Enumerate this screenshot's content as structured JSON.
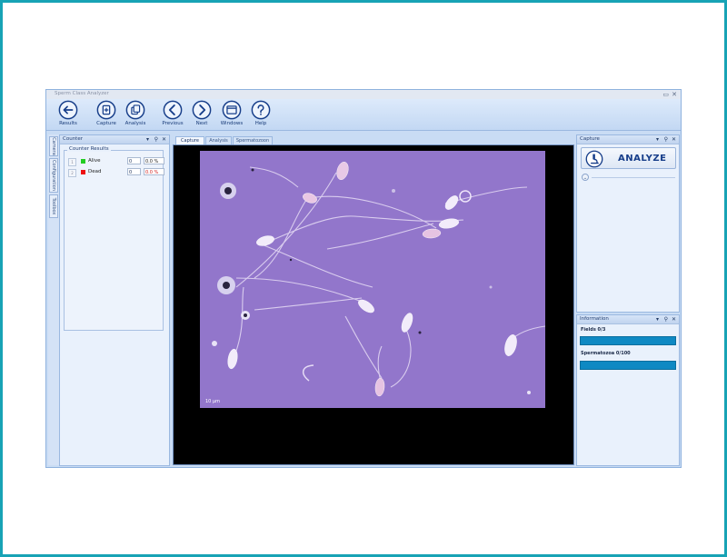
{
  "window": {
    "title": "Sperm Class Analyzer"
  },
  "toolbar": {
    "buttons": [
      {
        "label": "Results",
        "icon": "arrow-left-icon"
      },
      {
        "label": "Capture",
        "icon": "capture-icon"
      },
      {
        "label": "Analysis",
        "icon": "analysis-icon"
      },
      {
        "label": "Previous",
        "icon": "chevron-left-icon"
      },
      {
        "label": "Next",
        "icon": "chevron-right-icon"
      },
      {
        "label": "Windows",
        "icon": "windows-icon"
      },
      {
        "label": "Help",
        "icon": "help-icon"
      }
    ]
  },
  "side_tabs": [
    "Camera",
    "Configuration",
    "Toolbox"
  ],
  "counter_panel": {
    "title": "Counter",
    "group_title": "Counter Results",
    "rows": [
      {
        "index": "1",
        "name": "Alive",
        "color": "#22cc22",
        "count": "0",
        "percent": "0.0 %"
      },
      {
        "index": "2",
        "name": "Dead",
        "color": "#ee1111",
        "count": "0",
        "percent": "0.0 %"
      }
    ]
  },
  "doc_tabs": [
    {
      "label": "Capture",
      "active": true
    },
    {
      "label": "Analysis",
      "active": false
    },
    {
      "label": "Spermatozoon",
      "active": false
    }
  ],
  "image": {
    "scale_label": "10 µm",
    "stain_color": "#8e72c8"
  },
  "capture_panel": {
    "title": "Capture",
    "analyze_label": "ANALYZE"
  },
  "information_panel": {
    "title": "Information",
    "fields_label": "Fields 0/3",
    "fields_progress": 0,
    "spermatozoa_label": "Spermatozoa 0/100",
    "spermatozoa_progress": 0
  },
  "colors": {
    "accent": "#0f89c3",
    "frame": "#17a3b5",
    "ribbon": "#c3d8f3"
  }
}
